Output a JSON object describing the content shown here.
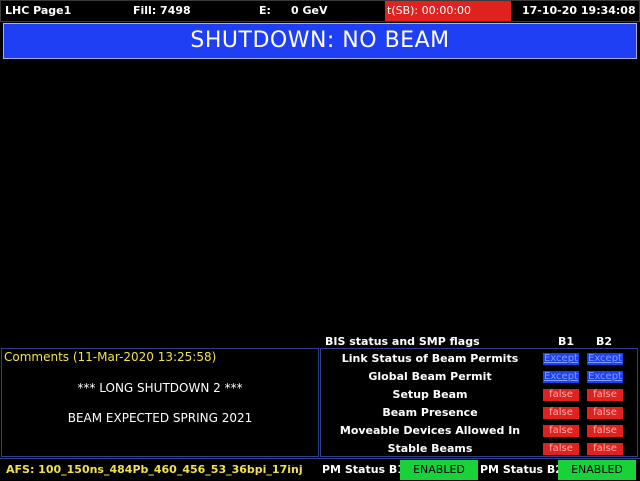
{
  "topbar": {
    "page": "LHC Page1",
    "fill": "Fill: 7498",
    "energy_label": "E:",
    "energy_value": "0 GeV",
    "sb_timer": "t(SB): 00:00:00",
    "datetime": "17-10-20 19:34:08"
  },
  "mode": "SHUTDOWN: NO BEAM",
  "bis": {
    "title": "BIS status and SMP flags",
    "col_b1": "B1",
    "col_b2": "B2",
    "flags": [
      {
        "label": "Link Status of Beam Permits",
        "b1": "Except",
        "b2": "Except",
        "status": "except"
      },
      {
        "label": "Global Beam Permit",
        "b1": "Except",
        "b2": "Except",
        "status": "except"
      },
      {
        "label": "Setup Beam",
        "b1": "false",
        "b2": "false",
        "status": "false"
      },
      {
        "label": "Beam Presence",
        "b1": "false",
        "b2": "false",
        "status": "false"
      },
      {
        "label": "Moveable Devices Allowed In",
        "b1": "false",
        "b2": "false",
        "status": "false"
      },
      {
        "label": "Stable Beams",
        "b1": "false",
        "b2": "false",
        "status": "false"
      }
    ]
  },
  "comments": {
    "title": "Comments (11-Mar-2020 13:25:58)",
    "line1": "*** LONG SHUTDOWN 2 ***",
    "line2": "BEAM EXPECTED SPRING 2021"
  },
  "bottom": {
    "afs": "AFS: 100_150ns_484Pb_460_456_53_36bpi_17inj",
    "pm_b1_label": "PM Status B1",
    "pm_b1_value": "ENABLED",
    "pm_b2_label": "PM Status B2",
    "pm_b2_value": "ENABLED"
  },
  "colors": {
    "banner_blue": "#1f3ff5",
    "status_red": "#e0211e",
    "enabled_green": "#19d23a",
    "comment_yellow": "#f0e050"
  }
}
